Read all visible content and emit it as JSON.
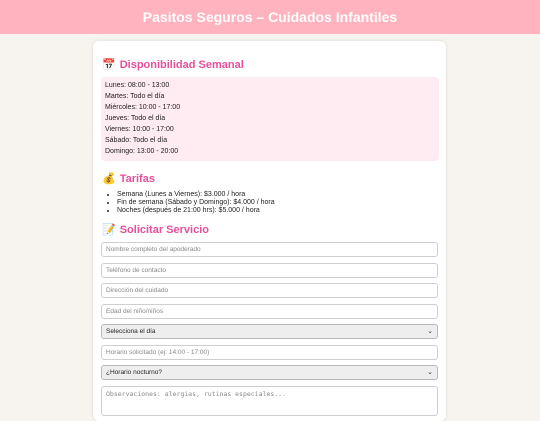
{
  "header": {
    "title": "Pasitos Seguros – Cuidados Infantiles"
  },
  "availability": {
    "icon": "calendar-icon",
    "title": "Disponibilidad Semanal",
    "lines": [
      "Lunes: 08:00 - 13:00",
      "Martes: Todo el día",
      "Miércoles: 10:00 - 17:00",
      "Jueves: Todo el día",
      "Viernes: 10:00 - 17:00",
      "Sábado: Todo el día",
      "Domingo: 13:00 - 20:00"
    ]
  },
  "rates": {
    "icon": "money-bag-icon",
    "title": "Tarifas",
    "items": [
      "Semana (Lunes a Viernes): $3.000 / hora",
      "Fin de semana (Sábado y Domingo): $4.000 / hora",
      "Noches (después de 21:00 hrs): $5.000 / hora"
    ]
  },
  "form": {
    "icon": "memo-icon",
    "title": "Solicitar Servicio",
    "fields": {
      "guardian_name": {
        "placeholder": "Nombre completo del apoderado"
      },
      "phone": {
        "placeholder": "Teléfono de contacto"
      },
      "address": {
        "placeholder": "Dirección del cuidado"
      },
      "child_age": {
        "placeholder": "Edad del niño/niños"
      },
      "day_select": {
        "value": "Selecciona el día"
      },
      "time": {
        "placeholder": "Horario solicitado (ej: 14:00 - 17:00)"
      },
      "night_select": {
        "value": "¿Horario nocturno?"
      },
      "notes": {
        "placeholder": "Observaciones: alergias, rutinas especiales..."
      }
    }
  }
}
